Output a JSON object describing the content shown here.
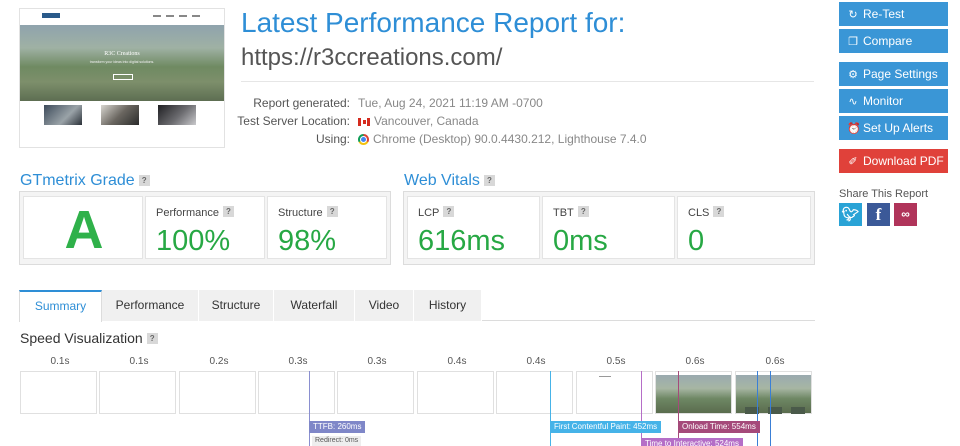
{
  "thumbnail": {
    "site_title": "R3C Creations",
    "site_subtitle": "transform your ideas into digital solutions."
  },
  "report": {
    "title": "Latest Performance Report for:",
    "url": "https://r3ccreations.com/",
    "generated_label": "Report generated:",
    "generated_value": "Tue, Aug 24, 2021 11:19 AM -0700",
    "server_label": "Test Server Location:",
    "server_value": "Vancouver, Canada",
    "using_label": "Using:",
    "using_value": "Chrome (Desktop) 90.0.4430.212, Lighthouse 7.4.0"
  },
  "sidebar": {
    "retest": "Re-Test",
    "compare": "Compare",
    "page_settings": "Page Settings",
    "monitor": "Monitor",
    "alerts": "Set Up Alerts",
    "download": "Download PDF",
    "share_label": "Share This Report",
    "icons": [
      "retest-icon",
      "compare-icon",
      "gear-icon",
      "monitor-icon",
      "alarm-clock-icon",
      "pdf-icon",
      "twitter-icon",
      "facebook-icon",
      "link-icon"
    ]
  },
  "grade": {
    "section_title": "GTmetrix Grade",
    "letter": "A",
    "performance_label": "Performance",
    "performance_value": "100%",
    "structure_label": "Structure",
    "structure_value": "98%"
  },
  "vitals": {
    "section_title": "Web Vitals",
    "lcp_label": "LCP",
    "lcp_value": "616ms",
    "tbt_label": "TBT",
    "tbt_value": "0ms",
    "cls_label": "CLS",
    "cls_value": "0"
  },
  "tabs": [
    "Summary",
    "Performance",
    "Structure",
    "Waterfall",
    "Video",
    "History"
  ],
  "speed": {
    "title": "Speed Visualization",
    "ticks": [
      "0.1s",
      "0.1s",
      "0.2s",
      "0.3s",
      "0.3s",
      "0.4s",
      "0.4s",
      "0.5s",
      "0.6s",
      "0.6s"
    ],
    "markers": {
      "ttfb": "TTFB: 260ms",
      "redirect": "Redirect: 0ms",
      "fcp": "First Contentful Paint: 452ms",
      "onload": "Onload Time: 554ms",
      "tti": "Time to Interactive: 524ms"
    }
  },
  "colors": {
    "accent": "#2e8ed6",
    "grade_green": "#2fb14a",
    "sidebar_button": "#3a96d6",
    "download_button": "#e0413a"
  }
}
